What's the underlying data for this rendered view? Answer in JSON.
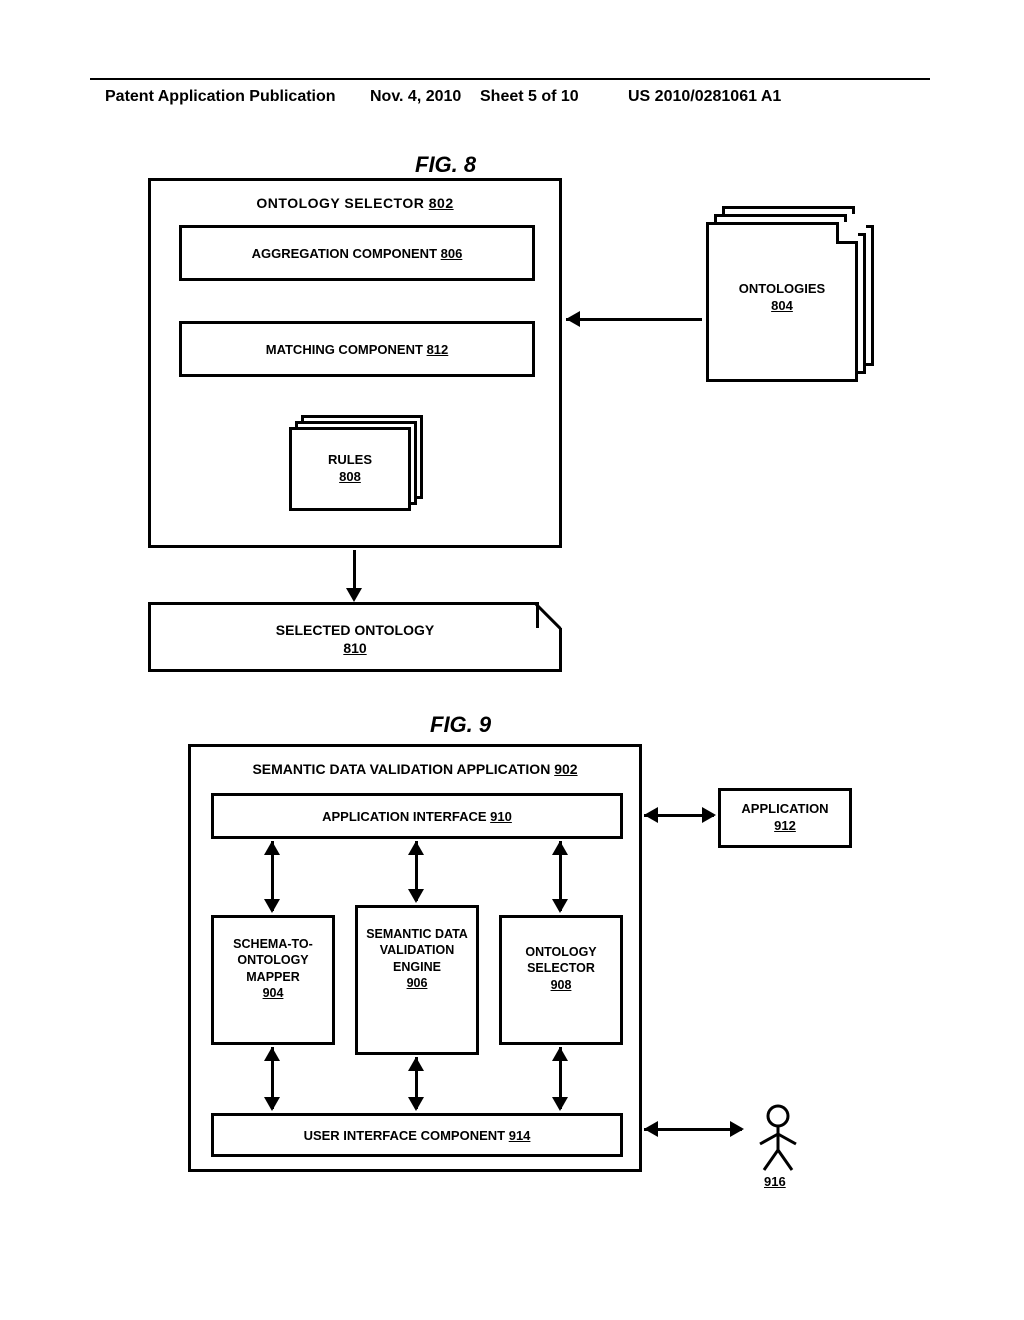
{
  "header": {
    "left": "Patent Application Publication",
    "date": "Nov. 4, 2010",
    "sheet": "Sheet 5 of 10",
    "pubno": "US 2010/0281061 A1"
  },
  "fig8": {
    "label": "FIG. 8",
    "box802": {
      "title": "ONTOLOGY SELECTOR",
      "ref": "802"
    },
    "box806": {
      "title": "AGGREGATION COMPONENT",
      "ref": "806"
    },
    "box812": {
      "title": "MATCHING COMPONENT",
      "ref": "812"
    },
    "box808": {
      "title": "RULES",
      "ref": "808"
    },
    "box804": {
      "title": "ONTOLOGIES",
      "ref": "804"
    },
    "box810": {
      "title": "SELECTED ONTOLOGY",
      "ref": "810"
    }
  },
  "fig9": {
    "label": "FIG. 9",
    "box902": {
      "title": "SEMANTIC DATA VALIDATION APPLICATION",
      "ref": "902"
    },
    "box910": {
      "title": "APPLICATION INTERFACE",
      "ref": "910"
    },
    "box904": {
      "title": "SCHEMA-TO-ONTOLOGY MAPPER",
      "ref": "904"
    },
    "box906": {
      "title": "SEMANTIC DATA VALIDATION ENGINE",
      "ref": "906"
    },
    "box908": {
      "title": "ONTOLOGY SELECTOR",
      "ref": "908"
    },
    "box914": {
      "title": "USER INTERFACE COMPONENT",
      "ref": "914"
    },
    "box912": {
      "title": "APPLICATION",
      "ref": "912"
    },
    "user916": {
      "ref": "916"
    }
  }
}
